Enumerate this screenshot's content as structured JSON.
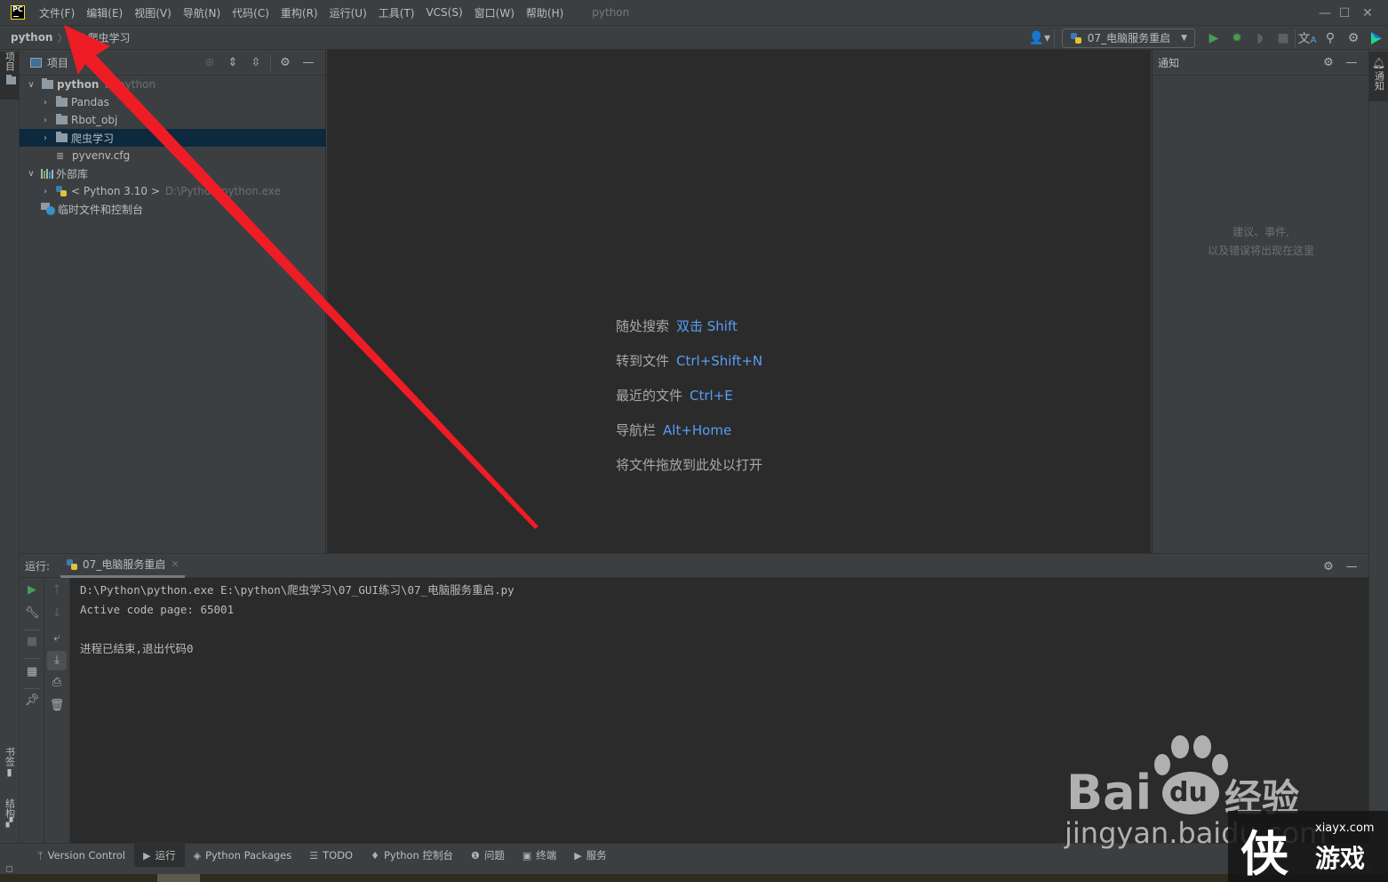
{
  "app": {
    "logo_text": "PC",
    "window_title": "python",
    "menu": [
      "文件(F)",
      "编辑(E)",
      "视图(V)",
      "导航(N)",
      "代码(C)",
      "重构(R)",
      "运行(U)",
      "工具(T)",
      "VCS(S)",
      "窗口(W)",
      "帮助(H)"
    ],
    "window_controls": {
      "minimize": "—",
      "maximize": "☐",
      "close": "✕"
    }
  },
  "navbar": {
    "breadcrumb": [
      "python",
      "爬虫学习"
    ],
    "run_config": "07_电脑服务重启"
  },
  "left_stripe": {
    "top": "项目",
    "bottom": [
      "书签",
      "结构"
    ]
  },
  "project_panel": {
    "title": "项目",
    "tree": [
      {
        "label": "python",
        "hint": "E:\\python",
        "level": 0,
        "expanded": true,
        "type": "folder",
        "bold": true
      },
      {
        "label": "Pandas",
        "level": 1,
        "expanded": false,
        "type": "folder"
      },
      {
        "label": "Rbot_obj",
        "level": 1,
        "expanded": false,
        "type": "folder"
      },
      {
        "label": "爬虫学习",
        "level": 1,
        "expanded": false,
        "type": "folder",
        "selected": true
      },
      {
        "label": "pyvenv.cfg",
        "level": 1,
        "type": "file"
      },
      {
        "label": "外部库",
        "level": 0,
        "expanded": true,
        "type": "library"
      },
      {
        "label": "< Python 3.10 >",
        "hint": "D:\\Python\\python.exe",
        "level": 1,
        "expanded": false,
        "type": "python"
      },
      {
        "label": "临时文件和控制台",
        "level": 0,
        "type": "scratch"
      }
    ]
  },
  "editor": {
    "hints": [
      {
        "text": "随处搜索",
        "key": "双击 Shift"
      },
      {
        "text": "转到文件",
        "key": "Ctrl+Shift+N"
      },
      {
        "text": "最近的文件",
        "key": "Ctrl+E"
      },
      {
        "text": "导航栏",
        "key": "Alt+Home"
      },
      {
        "text": "将文件拖放到此处以打开",
        "key": ""
      }
    ]
  },
  "notifications": {
    "title": "通知",
    "stripe_label": "通知",
    "empty_line1": "建议、事件,",
    "empty_line2": "以及错误将出现在这里"
  },
  "run_panel": {
    "label": "运行:",
    "tab": "07_电脑服务重启",
    "console": [
      "D:\\Python\\python.exe E:\\python\\爬虫学习\\07_GUI练习\\07_电脑服务重启.py",
      "Active code page: 65001",
      "",
      "进程已结束,退出代码0"
    ]
  },
  "bottom_tabs": [
    {
      "icon": "branch-icon",
      "glyph": "ᛘ",
      "label": "Version Control"
    },
    {
      "icon": "run-icon",
      "glyph": "▶",
      "label": "运行",
      "active": true
    },
    {
      "icon": "packages-icon",
      "glyph": "◈",
      "label": "Python Packages"
    },
    {
      "icon": "todo-icon",
      "glyph": "☰",
      "label": "TODO"
    },
    {
      "icon": "python-console-icon",
      "glyph": "♦",
      "label": "Python 控制台"
    },
    {
      "icon": "problems-icon",
      "glyph": "❶",
      "label": "问题"
    },
    {
      "icon": "terminal-icon",
      "glyph": "▣",
      "label": "终端"
    },
    {
      "icon": "services-icon",
      "glyph": "▶",
      "label": "服务"
    }
  ],
  "status": {
    "interpreter": "Python 3.10"
  },
  "watermarks": {
    "baidu_logo": "Bai",
    "baidu_du": "du",
    "baidu_cn": "经验",
    "baidu_url": "jingyan.baidu.com",
    "xia_char": "侠",
    "xia_url": "xiayx.com",
    "xia_name": "游戏"
  },
  "colors": {
    "accent_link": "#589df6",
    "selection": "#0d293e",
    "run_green": "#499c54",
    "arrow_red": "#ee1c25"
  }
}
